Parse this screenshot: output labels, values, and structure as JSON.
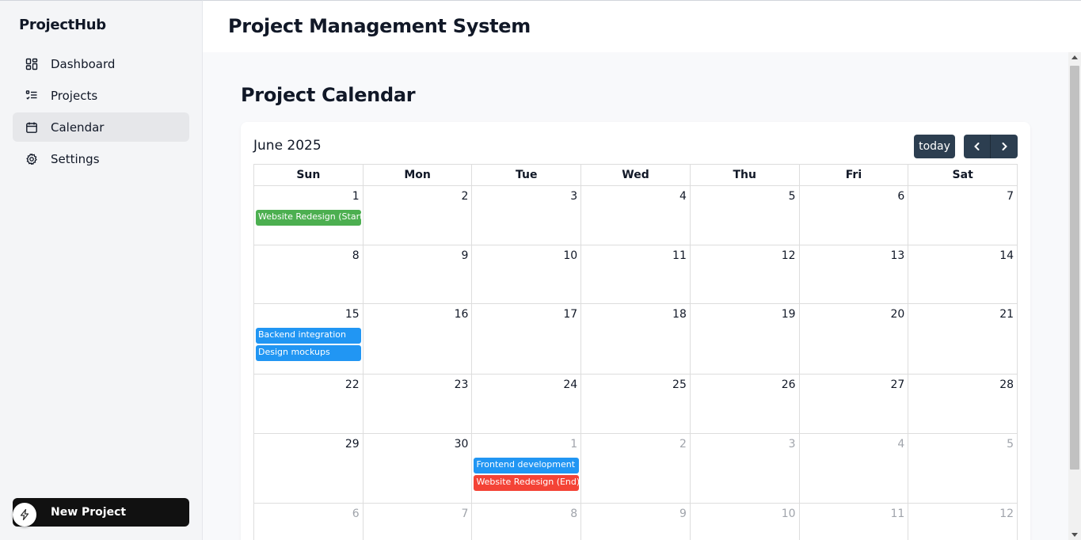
{
  "sidebar": {
    "brand": "ProjectHub",
    "items": [
      {
        "label": "Dashboard",
        "icon": "dashboard-icon",
        "active": false
      },
      {
        "label": "Projects",
        "icon": "list-icon",
        "active": false
      },
      {
        "label": "Calendar",
        "icon": "calendar-icon",
        "active": true
      },
      {
        "label": "Settings",
        "icon": "gear-icon",
        "active": false
      }
    ],
    "new_project_label": "New Project"
  },
  "header": {
    "title": "Project Management System"
  },
  "main": {
    "page_title": "Project Calendar"
  },
  "calendar": {
    "month_label": "June 2025",
    "today_label": "today",
    "day_names": [
      "Sun",
      "Mon",
      "Tue",
      "Wed",
      "Thu",
      "Fri",
      "Sat"
    ],
    "weeks": [
      {
        "days": [
          1,
          2,
          3,
          4,
          5,
          6,
          7
        ]
      },
      {
        "days": [
          8,
          9,
          10,
          11,
          12,
          13,
          14
        ]
      },
      {
        "days": [
          15,
          16,
          17,
          18,
          19,
          20,
          21
        ]
      },
      {
        "days": [
          22,
          23,
          24,
          25,
          26,
          27,
          28
        ]
      },
      {
        "days": [
          29,
          30,
          1,
          2,
          3,
          4,
          5
        ]
      },
      {
        "days": [
          6,
          7,
          8,
          9,
          10,
          11,
          12
        ]
      }
    ],
    "events": [
      {
        "title": "Website Redesign (Start)",
        "week": 0,
        "day": 0,
        "color": "#4caf50"
      },
      {
        "title": "Backend integration",
        "week": 2,
        "day": 0,
        "color": "#2196f3"
      },
      {
        "title": "Design mockups",
        "week": 2,
        "day": 0,
        "color": "#2196f3"
      },
      {
        "title": "Frontend development",
        "week": 4,
        "day": 2,
        "color": "#2196f3"
      },
      {
        "title": "Website Redesign (End)",
        "week": 4,
        "day": 2,
        "color": "#f44336"
      }
    ]
  },
  "colors": {
    "sidebar_bg": "#f4f5f7",
    "active_item_bg": "#e6e7ea",
    "button_dark": "#2c3e50",
    "new_project_bg": "#111111",
    "event_green": "#4caf50",
    "event_blue": "#2196f3",
    "event_red": "#f44336"
  }
}
